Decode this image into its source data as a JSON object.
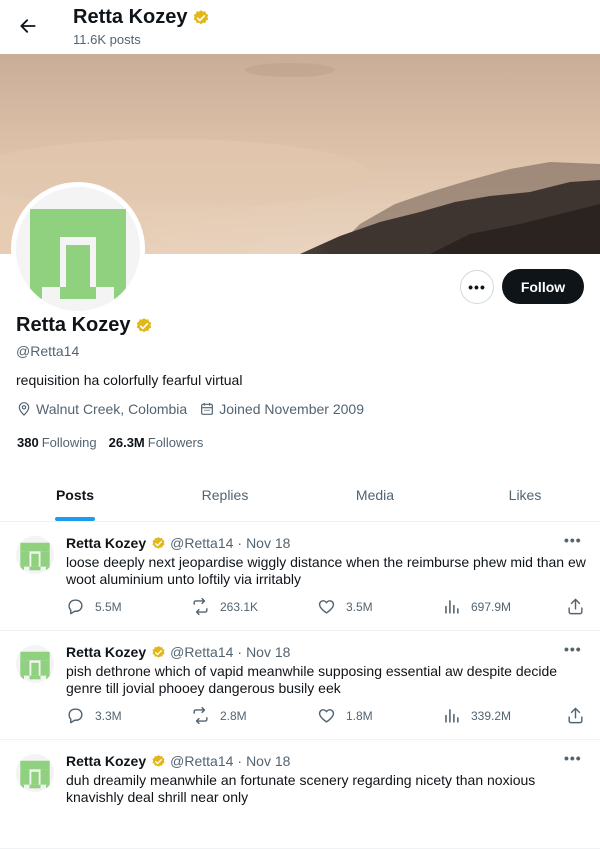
{
  "header": {
    "name": "Retta Kozey",
    "posts": "11.6K posts"
  },
  "profile": {
    "name": "Retta Kozey",
    "handle": "@Retta14",
    "bio": "requisition ha colorfully fearful virtual",
    "location": "Walnut Creek, Colombia",
    "joined": "Joined November 2009",
    "following_count": "380",
    "following_label": "Following",
    "followers_count": "26.3M",
    "followers_label": "Followers",
    "follow_label": "Follow",
    "more_label": "•••"
  },
  "tabs": [
    {
      "label": "Posts"
    },
    {
      "label": "Replies"
    },
    {
      "label": "Media"
    },
    {
      "label": "Likes"
    }
  ],
  "tweets": [
    {
      "name": "Retta Kozey",
      "handle": "@Retta14",
      "dot": "·",
      "date": "Nov 18",
      "text": "loose deeply next jeopardise wiggly distance when the reimburse phew mid than ew woot aluminium unto loftily via irritably",
      "replies": "5.5M",
      "reposts": "263.1K",
      "likes": "3.5M",
      "views": "697.9M"
    },
    {
      "name": "Retta Kozey",
      "handle": "@Retta14",
      "dot": "·",
      "date": "Nov 18",
      "text": "pish dethrone which of vapid meanwhile supposing essential aw despite decide genre till jovial phooey dangerous busily eek",
      "replies": "3.3M",
      "reposts": "2.8M",
      "likes": "1.8M",
      "views": "339.2M"
    },
    {
      "name": "Retta Kozey",
      "handle": "@Retta14",
      "dot": "·",
      "date": "Nov 18",
      "text": "duh dreamily meanwhile an fortunate scenery regarding nicety than noxious knavishly deal shrill near only",
      "replies": "",
      "reposts": "",
      "likes": "",
      "views": ""
    }
  ],
  "tweet_more_label": "•••",
  "colors": {
    "accent": "#1d9bf0",
    "verified": "#e2b719",
    "avatar_green": "#8fd17f",
    "follow_bg": "#0f1419"
  }
}
